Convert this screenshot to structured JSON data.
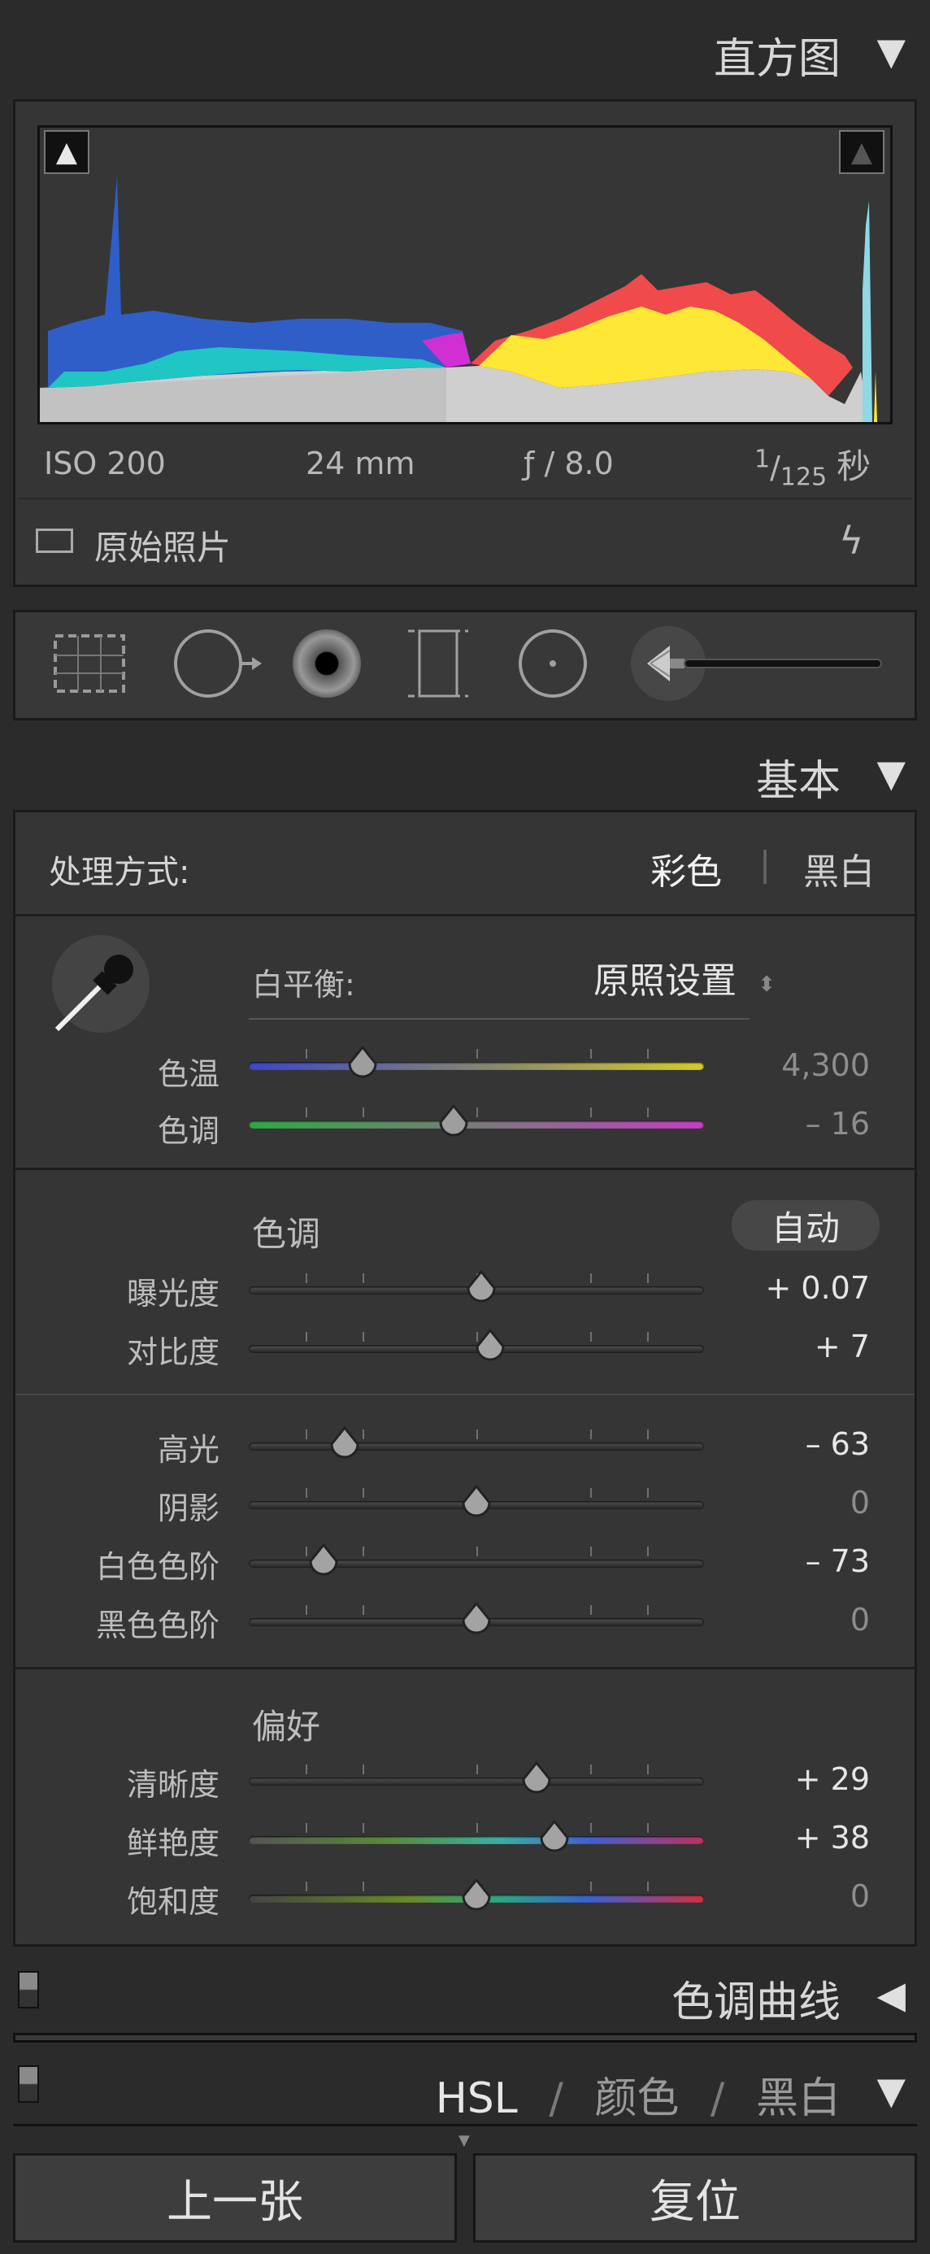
{
  "histogram_panel": {
    "title": "直方图",
    "iso": "ISO 200",
    "focal_length": "24 mm",
    "aperture": "ƒ / 8.0",
    "shutter_numerator": "1",
    "shutter_denominator": "125",
    "shutter_unit": "秒",
    "original_photo_label": "原始照片",
    "colors": {
      "blue": "#2f5ec8",
      "cyan": "#1fc6c4",
      "yellow": "#ffe835",
      "red": "#f04a4a",
      "magenta": "#d02fd4",
      "gray": "#cfcfcf"
    }
  },
  "tools": [
    "crop-overlay",
    "spot-removal",
    "red-eye",
    "graduated-filter",
    "radial-filter",
    "adjustment-brush"
  ],
  "basic_panel": {
    "title": "基本",
    "treatment_label": "处理方式:",
    "treatment_color": "彩色",
    "treatment_divider": "|",
    "treatment_bw": "黑白",
    "white_balance_label": "白平衡:",
    "white_balance_value": "原照设置",
    "temp": {
      "label": "色温",
      "value": "4,300",
      "position": 0.25
    },
    "tint": {
      "label": "色调",
      "value": "– 16",
      "position": 0.45
    },
    "tone_section_label": "色调",
    "auto_label": "自动",
    "exposure": {
      "label": "曝光度",
      "value": "+ 0.07",
      "position": 0.51
    },
    "contrast": {
      "label": "对比度",
      "value": "+ 7",
      "position": 0.53
    },
    "highlights": {
      "label": "高光",
      "value": "– 63",
      "position": 0.21
    },
    "shadows": {
      "label": "阴影",
      "value": "0",
      "position": 0.5
    },
    "whites": {
      "label": "白色色阶",
      "value": "– 73",
      "position": 0.165
    },
    "blacks": {
      "label": "黑色色阶",
      "value": "0",
      "position": 0.5
    },
    "presence_label": "偏好",
    "clarity": {
      "label": "清晰度",
      "value": "+ 29",
      "position": 0.63
    },
    "vibrance": {
      "label": "鲜艳度",
      "value": "+ 38",
      "position": 0.67
    },
    "saturation": {
      "label": "饱和度",
      "value": "0",
      "position": 0.5
    }
  },
  "tone_curve_panel": {
    "title": "色调曲线"
  },
  "hsl_panel": {
    "hsl": "HSL",
    "slash1": "/",
    "color": "颜色",
    "slash2": "/",
    "bw": "黑白"
  },
  "buttons": {
    "previous": "上一张",
    "reset": "复位"
  }
}
